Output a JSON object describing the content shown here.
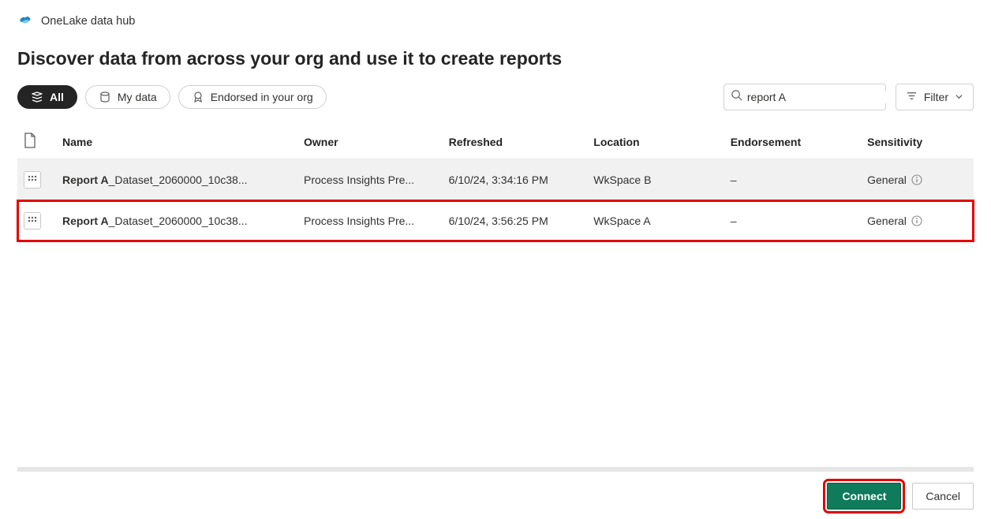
{
  "header": {
    "app_title": "OneLake data hub"
  },
  "page": {
    "heading": "Discover data from across your org and use it to create reports"
  },
  "pills": {
    "all": "All",
    "my_data": "My data",
    "endorsed": "Endorsed in your org"
  },
  "search": {
    "value": "report A"
  },
  "filter": {
    "label": "Filter"
  },
  "columns": {
    "name": "Name",
    "owner": "Owner",
    "refreshed": "Refreshed",
    "location": "Location",
    "endorsement": "Endorsement",
    "sensitivity": "Sensitivity"
  },
  "rows": [
    {
      "name_bold": "Report A",
      "name_rest": "_Dataset_2060000_10c38...",
      "owner": "Process Insights Pre...",
      "refreshed": "6/10/24, 3:34:16 PM",
      "location": "WkSpace B",
      "endorsement": "–",
      "sensitivity": "General"
    },
    {
      "name_bold": "Report A",
      "name_rest": "_Dataset_2060000_10c38...",
      "owner": "Process Insights Pre...",
      "refreshed": "6/10/24, 3:56:25 PM",
      "location": "WkSpace A",
      "endorsement": "–",
      "sensitivity": "General"
    }
  ],
  "footer": {
    "connect": "Connect",
    "cancel": "Cancel"
  }
}
